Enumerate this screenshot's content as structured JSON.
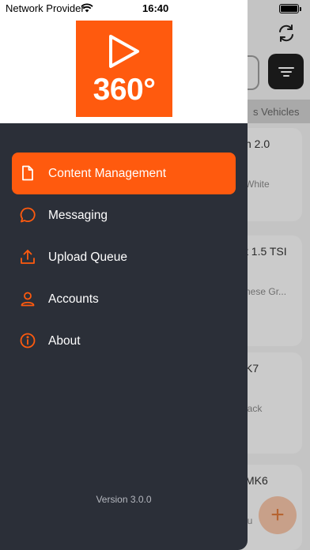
{
  "status_bar": {
    "carrier": "Network Provider",
    "time": "16:40",
    "battery_level": 1.0
  },
  "logo": {
    "text": "360°",
    "icon": "play-icon",
    "brand_color": "#ff5a0e"
  },
  "menu": {
    "active_color": "#ff5a0e",
    "items": [
      {
        "label": "Content Management",
        "icon": "document-icon",
        "active": true
      },
      {
        "label": "Messaging",
        "icon": "chat-bubble-icon",
        "active": false
      },
      {
        "label": "Upload Queue",
        "icon": "upload-icon",
        "active": false
      },
      {
        "label": "Accounts",
        "icon": "person-icon",
        "active": false
      },
      {
        "label": "About",
        "icon": "info-icon",
        "active": false
      }
    ]
  },
  "version": "Version 3.0.0",
  "background": {
    "filter_tab": "s Vehicles",
    "cards": [
      {
        "title": "n 2.0",
        "subtitle": "White"
      },
      {
        "title": "t 1.5 TSI",
        "subtitle": "nese Gr..."
      },
      {
        "title": "K7",
        "subtitle": "lack"
      },
      {
        "title": "MK6",
        "subtitle": "lu"
      }
    ],
    "fab_label": "+"
  }
}
